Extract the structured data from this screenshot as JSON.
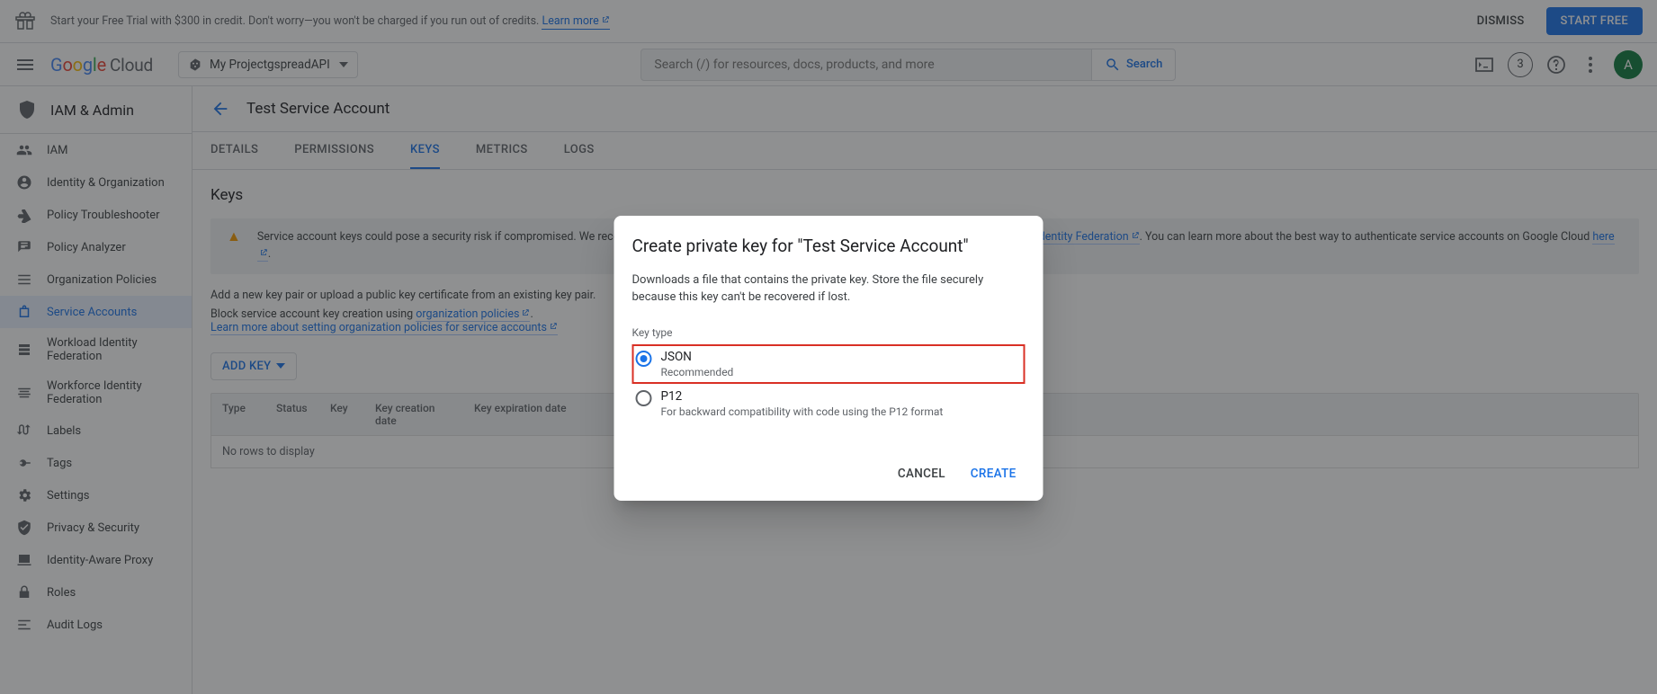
{
  "banner": {
    "text_prefix": "Start your Free Trial with $300 in credit. Don't worry—you won't be charged if you run out of credits. ",
    "learn_more": "Learn more",
    "dismiss": "DISMISS",
    "start_free": "START FREE"
  },
  "header": {
    "logo_cloud": "Cloud",
    "project_name": "My ProjectgspreadAPI",
    "search_placeholder": "Search (/) for resources, docs, products, and more",
    "search_label": "Search",
    "badge_count": "3",
    "avatar_initial": "A"
  },
  "sidebar": {
    "title": "IAM & Admin",
    "items": [
      {
        "label": "IAM"
      },
      {
        "label": "Identity & Organization"
      },
      {
        "label": "Policy Troubleshooter"
      },
      {
        "label": "Policy Analyzer"
      },
      {
        "label": "Organization Policies"
      },
      {
        "label": "Service Accounts"
      },
      {
        "label": "Workload Identity Federation"
      },
      {
        "label": "Workforce Identity Federation"
      },
      {
        "label": "Labels"
      },
      {
        "label": "Tags"
      },
      {
        "label": "Settings"
      },
      {
        "label": "Privacy & Security"
      },
      {
        "label": "Identity-Aware Proxy"
      },
      {
        "label": "Roles"
      },
      {
        "label": "Audit Logs"
      }
    ]
  },
  "page": {
    "title": "Test Service Account",
    "tabs": [
      "DETAILS",
      "PERMISSIONS",
      "KEYS",
      "METRICS",
      "LOGS"
    ],
    "section_title": "Keys",
    "warn_pre": "Service account keys could pose a security risk if compromised. We recommend you avoid downloading service account keys and instead use the ",
    "warn_link1": "Workload Identity Federation",
    "warn_post": ". You can learn more about the best way to authenticate service accounts on Google Cloud ",
    "warn_link2": "here",
    "line1": "Add a new key pair or upload a public key certificate from an existing key pair.",
    "line2_pre": "Block service account key creation using ",
    "line2_link": "organization policies",
    "line3_link": "Learn more about setting organization policies for service accounts",
    "add_key": "ADD KEY",
    "th": [
      "Type",
      "Status",
      "Key",
      "Key creation date",
      "Key expiration date"
    ],
    "empty": "No rows to display"
  },
  "dialog": {
    "title": "Create private key for \"Test Service Account\"",
    "desc": "Downloads a file that contains the private key. Store the file securely because this key can't be recovered if lost.",
    "key_type_label": "Key type",
    "opt1_title": "JSON",
    "opt1_sub": "Recommended",
    "opt2_title": "P12",
    "opt2_sub": "For backward compatibility with code using the P12 format",
    "cancel": "CANCEL",
    "create": "CREATE"
  }
}
